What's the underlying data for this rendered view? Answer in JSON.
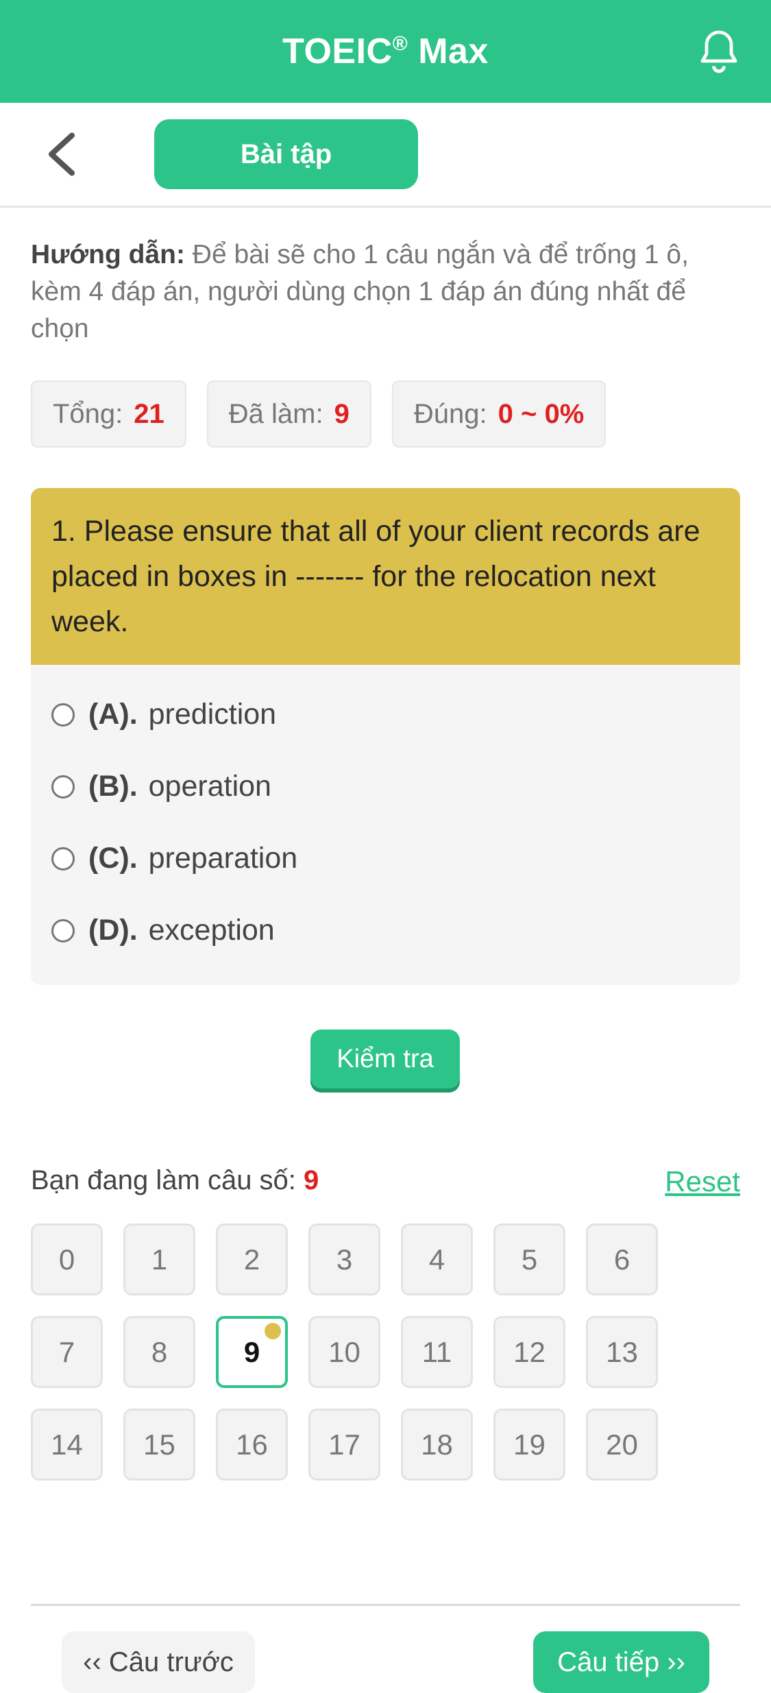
{
  "header": {
    "title": "TOEIC",
    "title_reg": "®",
    "title_suffix": "Max",
    "notification_icon": "bell-icon"
  },
  "subheader": {
    "back_icon": "chevron-left-icon",
    "tab_label": "Bài tập"
  },
  "instructions": {
    "label": "Hướng dẫn:",
    "text": "Để bài sẽ cho 1 câu ngắn và để trống 1 ô, kèm 4 đáp án, người dùng chọn 1 đáp án đúng nhất để chọn"
  },
  "stats": {
    "total_label": "Tổng:",
    "total_value": "21",
    "done_label": "Đã làm:",
    "done_value": "9",
    "correct_label": "Đúng:",
    "correct_value": "0 ~ 0%"
  },
  "question": {
    "text": "1. Please ensure that all of your client records are placed in boxes in ------- for the relocation next week.",
    "options": [
      {
        "key": "(A).",
        "text": "prediction"
      },
      {
        "key": "(B).",
        "text": "operation"
      },
      {
        "key": "(C).",
        "text": "preparation"
      },
      {
        "key": "(D).",
        "text": "exception"
      }
    ]
  },
  "check_button": "Kiểm tra",
  "progress": {
    "current_label": "Bạn đang làm câu số:",
    "current_value": "9",
    "reset_label": "Reset",
    "numbers": [
      "0",
      "1",
      "2",
      "3",
      "4",
      "5",
      "6",
      "7",
      "8",
      "9",
      "10",
      "11",
      "12",
      "13",
      "14",
      "15",
      "16",
      "17",
      "18",
      "19",
      "20"
    ],
    "active_index": 9
  },
  "nav": {
    "prev_label": "‹‹ Câu trước",
    "next_label": "Câu tiếp ››"
  },
  "colors": {
    "brand": "#2dc489",
    "question_bg": "#dcc04e",
    "accent_red": "#e02020"
  }
}
